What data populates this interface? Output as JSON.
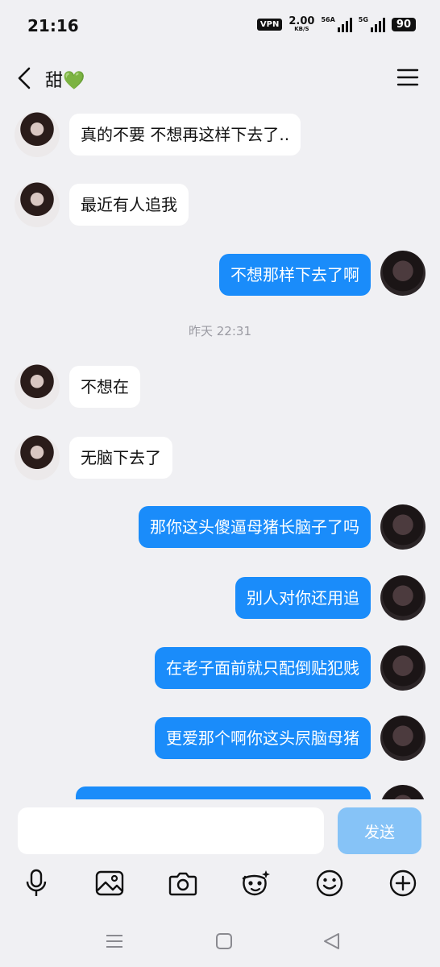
{
  "status_bar": {
    "time": "21:16",
    "vpn": "VPN",
    "speed_value": "2.00",
    "speed_unit": "KB/S",
    "signal1_label": "56A",
    "signal2_label": "5G",
    "battery": "90"
  },
  "header": {
    "title": "甜💚",
    "back_icon": "chevron-left-icon",
    "menu_icon": "menu-icon"
  },
  "messages": [
    {
      "side": "in",
      "text": "真的不要 不想再这样下去了.."
    },
    {
      "side": "in",
      "text": "最近有人追我"
    },
    {
      "side": "out",
      "text": "不想那样下去了啊"
    },
    {
      "timestamp": "昨天 22:31"
    },
    {
      "side": "in",
      "text": "不想在"
    },
    {
      "side": "in",
      "text": "无脑下去了"
    },
    {
      "side": "out",
      "text": "那你这头傻逼母猪长脑子了吗"
    },
    {
      "side": "out",
      "text": "别人对你还用追"
    },
    {
      "side": "out",
      "text": "在老子面前就只配倒贴犯贱"
    },
    {
      "side": "out",
      "text": "更爱那个啊你这头屄脑母猪"
    },
    {
      "side": "out",
      "text": ""
    }
  ],
  "input": {
    "placeholder": "",
    "send_label": "发送"
  },
  "toolbar": [
    "microphone-icon",
    "image-icon",
    "camera-icon",
    "face-sticker-icon",
    "emoji-icon",
    "plus-circle-icon"
  ],
  "nav": [
    "menu-lines-icon",
    "home-square-icon",
    "back-triangle-icon"
  ],
  "colors": {
    "outgoing_bubble": "#1a8cfa",
    "incoming_bubble": "#ffffff",
    "background": "#f0f0f3",
    "send_button": "#86c3f7"
  }
}
